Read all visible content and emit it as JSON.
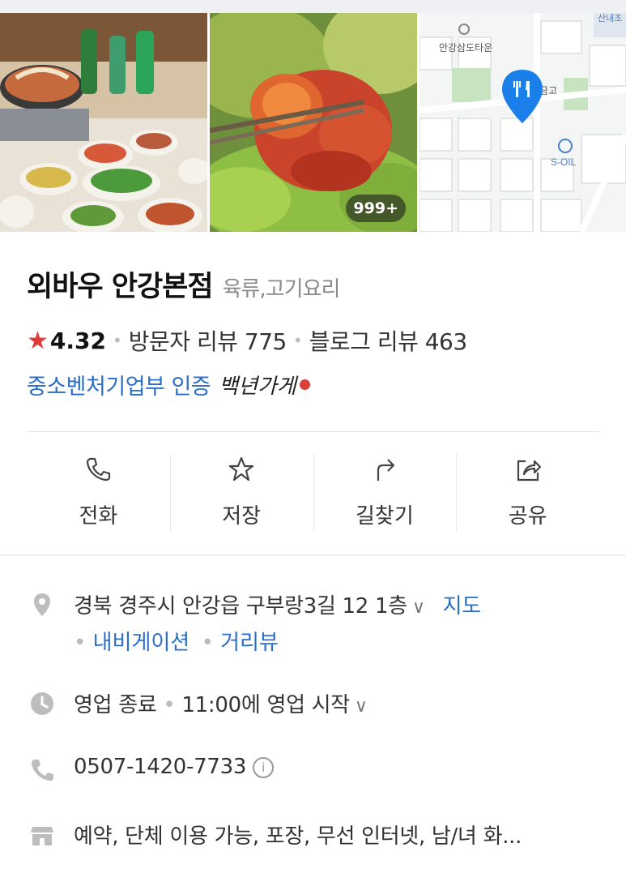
{
  "gallery": {
    "photo_count_badge": "999+",
    "map": {
      "label_top_right": "산내초",
      "label_town": "안강삼도타운",
      "label_poi": "금고",
      "label_gas": "S-OIL"
    }
  },
  "place": {
    "name": "외바우 안강본점",
    "category": "육류,고기요리",
    "rating": "4.32",
    "visitor_reviews": "방문자 리뷰 775",
    "blog_reviews": "블로그 리뷰 463",
    "certification": "중소벤처기업부 인증",
    "century_store": "백년가게"
  },
  "actions": [
    {
      "label": "전화",
      "icon": "phone-icon"
    },
    {
      "label": "저장",
      "icon": "star-outline-icon"
    },
    {
      "label": "길찾기",
      "icon": "directions-icon"
    },
    {
      "label": "공유",
      "icon": "share-icon"
    }
  ],
  "info": {
    "address": "경북 경주시 안강읍 구부랑3길 12 1층",
    "map_link": "지도",
    "navigation_link": "내비게이션",
    "streetview_link": "거리뷰",
    "status": "영업 종료",
    "next_open": "11:00에 영업 시작",
    "phone": "0507-1420-7733",
    "facilities": "예약, 단체 이용 가능, 포장, 무선 인터넷, 남/녀 화..."
  },
  "colors": {
    "accent_blue": "#2a6ec9",
    "star_red": "#e03b3b",
    "map_pin": "#1a7fe8"
  }
}
